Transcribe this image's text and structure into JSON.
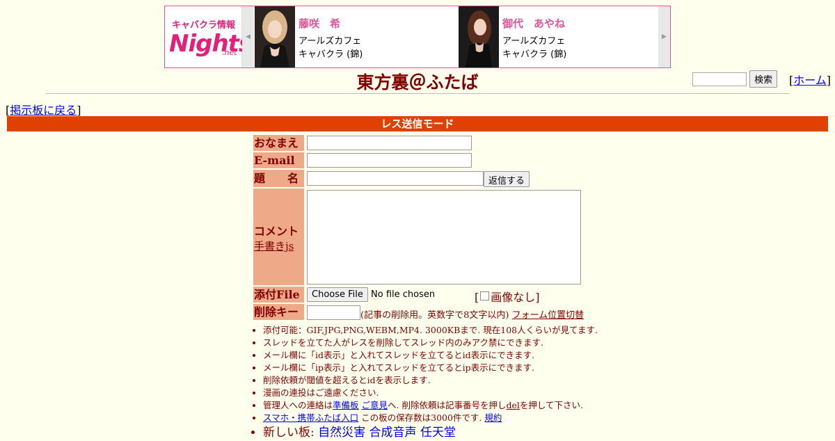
{
  "ad": {
    "logo": {
      "line1": "キャバクラ情報",
      "line2": "Nights",
      "line3": ".net"
    },
    "prev_arrow": "◀",
    "next_arrow": "▶",
    "cards": [
      {
        "name": "藤咲　希",
        "shop": "アールズカフェ",
        "type": "キャバクラ (錦)"
      },
      {
        "name": "御代　あやね",
        "shop": "アールズカフェ",
        "type": "キャバクラ (錦)"
      }
    ]
  },
  "header": {
    "title": "東方裏＠ふたば",
    "search_button": "検索",
    "home_open": "[",
    "home_link": "ホーム",
    "home_close": "]"
  },
  "nav": {
    "back_open": "[",
    "back_link": "掲示板に戻る",
    "back_close": "]"
  },
  "mode_bar": "レス送信モード",
  "form": {
    "name_label": "おなまえ",
    "email_label": "E-mail",
    "subject_label": "題　　名",
    "submit_button": "返信する",
    "comment_label": "コメント",
    "handwriting_link": "手書きjs",
    "file_label": "添付File",
    "file_button": "Choose File",
    "file_status": "No file chosen",
    "noimage_open": "[",
    "noimage_label": "画像なし]",
    "delkey_label": "削除キー",
    "delkey_note": "(記事の削除用。英数字で8文字以内)",
    "form_toggle_link": "フォーム位置切替"
  },
  "rules": {
    "r1": "添付可能：GIF,JPG,PNG,WEBM,MP4. 3000KBまで. 現在108人くらいが見てます.",
    "r2": "スレッドを立てた人がレスを削除してスレッド内のみアク禁にできます.",
    "r3": "メール欄に「id表示」と入れてスレッドを立てるとid表示にできます.",
    "r4": "メール欄に「ip表示」と入れてスレッドを立てるとip表示にできます.",
    "r5": "削除依頼が閾値を超えるとidを表示します.",
    "r6": "漫画の連投はご遠慮ください.",
    "r7_pre": "管理人への連絡は",
    "r7_link1": "準備板",
    "r7_link2": "ご意見",
    "r7_mid": "へ. 削除依頼は記事番号を押し",
    "r7_del": "del",
    "r7_post": "を押して下さい.",
    "r8_link": "スマホ・携帯ふたば入口",
    "r8_mid": "この板の保存数は3000件です.",
    "r8_link2": "規約",
    "r9_pre": "新しい板:",
    "r9_links": [
      "自然災害",
      "合成音声",
      "任天堂"
    ]
  }
}
